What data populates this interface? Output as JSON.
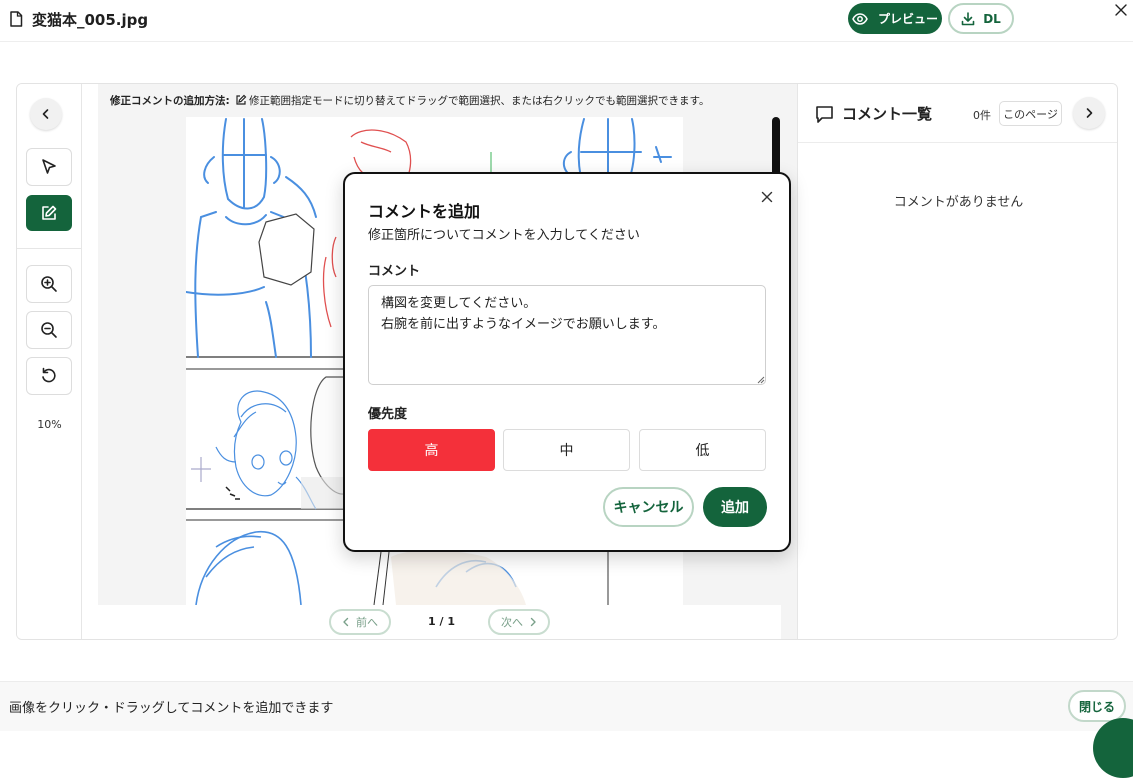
{
  "header": {
    "file_name": "変猫本_005.jpg",
    "preview_label": "プレビュー",
    "download_label": "DL"
  },
  "toolbar": {
    "zoom_level": "10%"
  },
  "canvas": {
    "instruction_bold": "修正コメントの追加方法:",
    "instruction_text": "修正範囲指定モードに切り替えてドラッグで範囲選択、または右クリックでも範囲選択できます。",
    "prev_label": "前へ",
    "next_label": "次へ",
    "page_indicator": "1 / 1"
  },
  "comments_panel": {
    "title": "コメント一覧",
    "count": "0件",
    "this_page_label": "このページ",
    "empty_text": "コメントがありません"
  },
  "modal": {
    "title": "コメントを追加",
    "subtitle": "修正箇所についてコメントを入力してください",
    "comment_label": "コメント",
    "comment_value": "構図を変更してください。\n右腕を前に出すようなイメージでお願いします。",
    "priority_label": "優先度",
    "priority_options": [
      "高",
      "中",
      "低"
    ],
    "priority_selected": "高",
    "cancel_label": "キャンセル",
    "add_label": "追加"
  },
  "footer": {
    "hint": "画像をクリック・ドラッグしてコメントを追加できます",
    "close_label": "閉じる"
  },
  "colors": {
    "brand_green": "#14643c",
    "priority_high": "#f4303a",
    "sketch_blue": "#4a8fe0",
    "sketch_red": "#e05050"
  }
}
